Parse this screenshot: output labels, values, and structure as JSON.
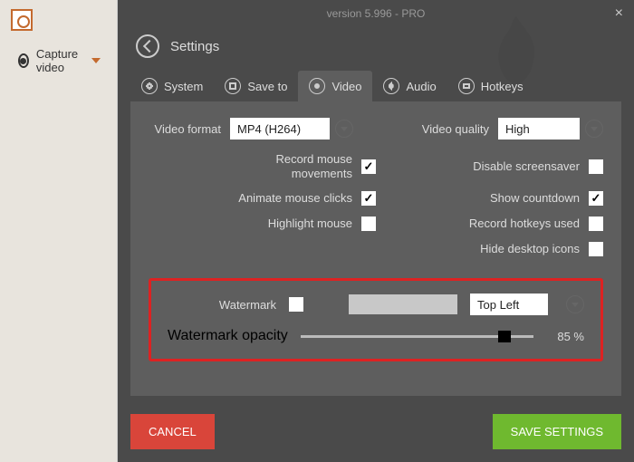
{
  "title": "version 5.996 - PRO",
  "sidebar": {
    "capture": "Capture video"
  },
  "header": {
    "back": "Settings"
  },
  "tabs": {
    "system": "System",
    "saveto": "Save to",
    "video": "Video",
    "audio": "Audio",
    "hotkeys": "Hotkeys"
  },
  "video": {
    "format_label": "Video format",
    "format_value": "MP4 (H264)",
    "quality_label": "Video quality",
    "quality_value": "High",
    "left": {
      "record_mouse": "Record mouse movements",
      "animate_clicks": "Animate mouse clicks",
      "highlight_mouse": "Highlight mouse"
    },
    "right": {
      "disable_ss": "Disable screensaver",
      "show_countdown": "Show countdown",
      "record_hotkeys": "Record hotkeys used",
      "hide_icons": "Hide desktop icons"
    },
    "checked": {
      "record_mouse": true,
      "animate_clicks": true,
      "highlight_mouse": false,
      "disable_ss": false,
      "show_countdown": true,
      "record_hotkeys": false,
      "hide_icons": false,
      "watermark": false
    },
    "watermark": {
      "label": "Watermark",
      "position": "Top Left",
      "opacity_label": "Watermark opacity",
      "opacity_value": "85 %",
      "opacity_pct": 85
    }
  },
  "buttons": {
    "cancel": "CANCEL",
    "save": "SAVE SETTINGS"
  }
}
